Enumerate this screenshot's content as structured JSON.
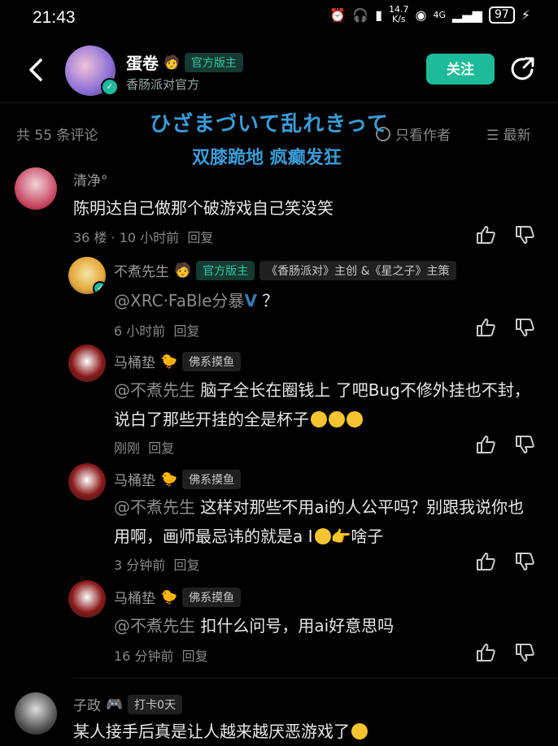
{
  "status_bar": {
    "time": "21:43",
    "net_speed_top": "14.7",
    "net_speed_bottom": "K/s",
    "signal": "4G",
    "battery": "97"
  },
  "header": {
    "name": "蛋卷",
    "badge": "官方版主",
    "subtitle": "香肠派对官方",
    "follow_label": "关注"
  },
  "overlay": {
    "line1": "ひざまづいて乱れきって",
    "line2": "双膝跪地 疯癫发狂"
  },
  "toolbar": {
    "count_label": "共 55 条评论",
    "only_author": "只看作者",
    "sort": "最新"
  },
  "comments": [
    {
      "name": "清净°",
      "text": "陈明达自己做那个破游戏自己笑没笑",
      "meta": "36 楼 · 10 小时前",
      "reply": "回复"
    },
    {
      "name": "不煮先生",
      "badge": "官方版主",
      "desc": "《香肠派对》主创 &《星之子》主策",
      "mention": "@XRC·FaBle分暴",
      "text": " ？",
      "meta": "6 小时前",
      "reply": "回复"
    },
    {
      "name": "马桶垫",
      "tag": "佛系摸鱼",
      "mention": "@不煮先生",
      "text": " 脑子全长在圈钱上 了吧Bug不修外挂也不封，说白了那些开挂的全是杯子",
      "meta": "刚刚",
      "reply": "回复"
    },
    {
      "name": "马桶垫",
      "tag": "佛系摸鱼",
      "mention": "@不煮先生",
      "text": " 这样对那些不用ai的人公平吗？别跟我说你也用啊，画师最忌讳的就是a I",
      "text2": "啥子",
      "meta": "3 分钟前",
      "reply": "回复"
    },
    {
      "name": "马桶垫",
      "tag": "佛系摸鱼",
      "mention": "@不煮先生",
      "text": " 扣什么问号，用ai好意思吗",
      "meta": "16 分钟前",
      "reply": "回复"
    },
    {
      "name": "子政",
      "tag": "打卡0天",
      "text": "某人接手后真是让人越来越厌恶游戏了"
    }
  ],
  "icons": [
    "back-icon",
    "share-icon",
    "radio-icon",
    "sort-icon",
    "like-icon",
    "dislike-icon",
    "verified-icon"
  ]
}
